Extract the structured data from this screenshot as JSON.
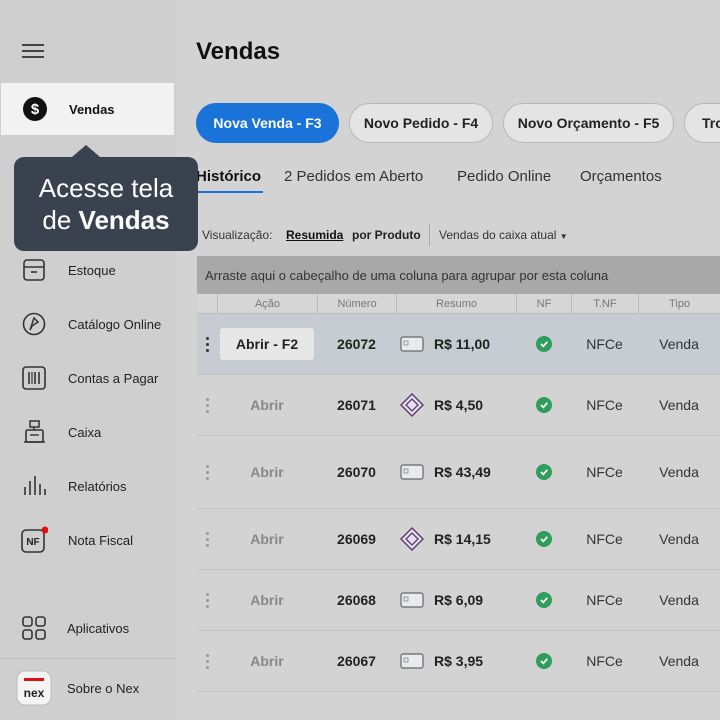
{
  "sidebar": {
    "items": [
      {
        "label": "Vendas",
        "icon": "dollar-icon"
      },
      {
        "label": "Estoque",
        "icon": "box-icon"
      },
      {
        "label": "Catálogo Online",
        "icon": "catalog-icon"
      },
      {
        "label": "Contas a Pagar",
        "icon": "barcode-icon"
      },
      {
        "label": "Caixa",
        "icon": "cash-register-icon"
      },
      {
        "label": "Relatórios",
        "icon": "chart-icon"
      },
      {
        "label": "Nota Fiscal",
        "icon": "nf-icon"
      },
      {
        "label": "Aplicativos",
        "icon": "apps-grid-icon"
      },
      {
        "label": "Sobre o Nex",
        "icon": "nex-logo-icon"
      }
    ],
    "nf_badge": "NF",
    "nex_logo_text": "nex"
  },
  "tooltip": {
    "line1": "Acesse tela",
    "line2_prefix": "de ",
    "line2_bold": "Vendas"
  },
  "page": {
    "title": "Vendas"
  },
  "actions": [
    {
      "label": "Nova Venda - F3"
    },
    {
      "label": "Novo Pedido - F4"
    },
    {
      "label": "Novo Orçamento - F5"
    },
    {
      "label": "Tro"
    }
  ],
  "tabs": [
    {
      "label": "Histórico"
    },
    {
      "label": "2 Pedidos em Aberto"
    },
    {
      "label": "Pedido Online"
    },
    {
      "label": "Orçamentos"
    }
  ],
  "visualization": {
    "label": "Visualização:",
    "option1": "Resumida",
    "option2": "por Produto",
    "filter": "Vendas do caixa atual"
  },
  "grid": {
    "group_hint": "Arraste aqui o cabeçalho de uma coluna para agrupar por esta coluna",
    "columns": [
      "Ação",
      "Número",
      "Resumo",
      "NF",
      "T.NF",
      "Tipo"
    ],
    "rows": [
      {
        "action": "Abrir - F2",
        "number": "26072",
        "pay": "card",
        "total": "R$ 11,00",
        "tnf": "NFCe",
        "type": "Venda"
      },
      {
        "action": "Abrir",
        "number": "26071",
        "pay": "pix",
        "total": "R$ 4,50",
        "tnf": "NFCe",
        "type": "Venda"
      },
      {
        "action": "Abrir",
        "number": "26070",
        "pay": "card",
        "total": "R$ 43,49",
        "tnf": "NFCe",
        "type": "Venda"
      },
      {
        "action": "Abrir",
        "number": "26069",
        "pay": "pix",
        "total": "R$ 14,15",
        "tnf": "NFCe",
        "type": "Venda"
      },
      {
        "action": "Abrir",
        "number": "26068",
        "pay": "card",
        "total": "R$ 6,09",
        "tnf": "NFCe",
        "type": "Venda"
      },
      {
        "action": "Abrir",
        "number": "26067",
        "pay": "card",
        "total": "R$ 3,95",
        "tnf": "NFCe",
        "type": "Venda"
      }
    ]
  },
  "colors": {
    "primary": "#1a73d9",
    "success": "#2e9e5a",
    "tooltip": "#3a4250",
    "badge": "#e01010"
  }
}
